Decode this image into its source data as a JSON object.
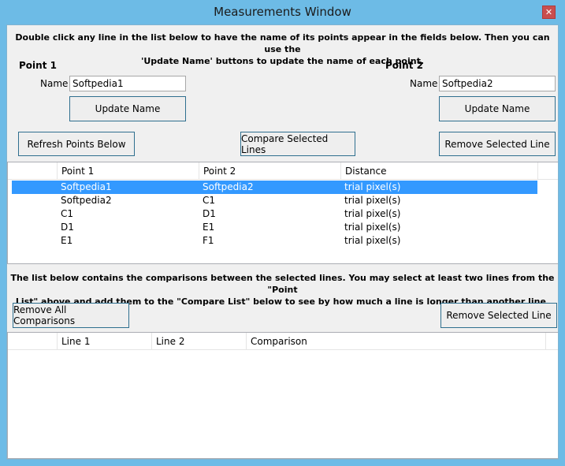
{
  "window": {
    "title": "Measurements Window"
  },
  "intro": {
    "line1": "Double click any line in the list below to have the name of its points appear in the fields below. Then you can use the",
    "line2": "'Update Name' buttons to update the name of each point."
  },
  "point1": {
    "heading": "Point 1",
    "name_label": "Name",
    "name_value": "Softpedia1",
    "update_label": "Update Name"
  },
  "point2": {
    "heading": "Point 2",
    "name_label": "Name",
    "name_value": "Softpedia2",
    "update_label": "Update Name"
  },
  "buttons": {
    "refresh": "Refresh Points Below",
    "compare": "Compare Selected Lines",
    "remove_line": "Remove Selected Line",
    "remove_all": "Remove All Comparisons",
    "remove_line2": "Remove Selected Line"
  },
  "points_list": {
    "headers": [
      "Point 1",
      "Point 2",
      "Distance"
    ],
    "rows": [
      [
        "Softpedia1",
        "Softpedia2",
        "trial pixel(s)"
      ],
      [
        "Softpedia2",
        "C1",
        "trial pixel(s)"
      ],
      [
        "C1",
        "D1",
        "trial pixel(s)"
      ],
      [
        "D1",
        "E1",
        "trial pixel(s)"
      ],
      [
        "E1",
        "F1",
        "trial pixel(s)"
      ]
    ],
    "selected_index": 0
  },
  "compare_info": {
    "line1": "The list below contains the comparisons between the selected lines. You may select at least two lines from the \"Point",
    "line2": "List\" above and add them to the \"Compare List\" below to see by how much a line is longer than another line."
  },
  "compare_list": {
    "headers": [
      "Line 1",
      "Line 2",
      "Comparison"
    ]
  }
}
